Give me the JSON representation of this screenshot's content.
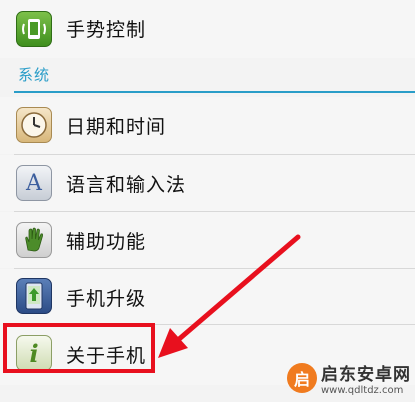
{
  "items_top": [
    {
      "label": "手势控制",
      "icon": "gesture-control-icon"
    }
  ],
  "section": {
    "title": "系统"
  },
  "items": [
    {
      "label": "日期和时间",
      "icon": "clock-icon"
    },
    {
      "label": "语言和输入法",
      "icon": "language-a-icon"
    },
    {
      "label": "辅助功能",
      "icon": "hand-icon"
    },
    {
      "label": "手机升级",
      "icon": "phone-upgrade-icon"
    },
    {
      "label": "关于手机",
      "icon": "info-icon"
    }
  ],
  "watermark": {
    "title": "启东安卓网",
    "url": "www.qdltdz.com",
    "logo_char": "启"
  },
  "colors": {
    "section_accent": "#2a9dc8",
    "highlight": "#e8101e",
    "arrow": "#e8101e"
  }
}
